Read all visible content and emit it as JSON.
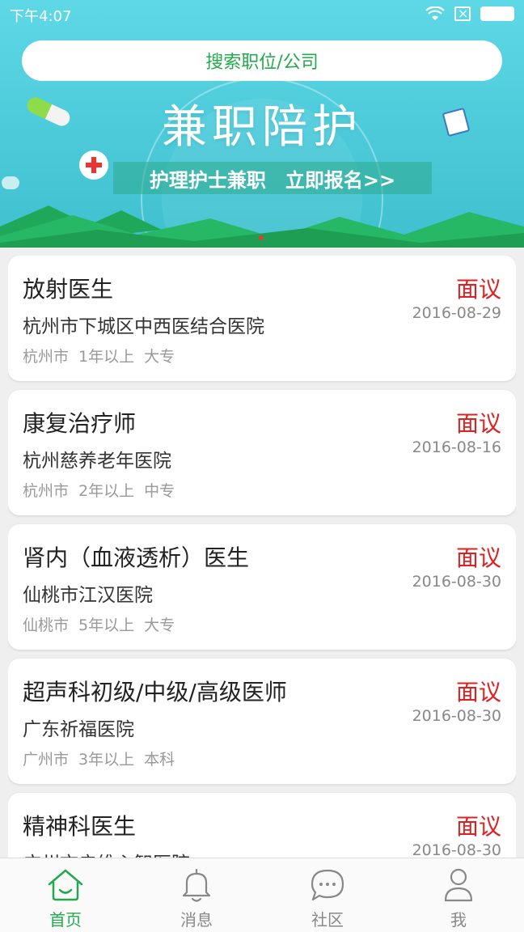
{
  "status_bar": {
    "time": "下午4:07"
  },
  "search": {
    "placeholder": "搜索职位/公司"
  },
  "banner": {
    "title": "兼职陪护",
    "subtitle_left": "护理护士兼职",
    "subtitle_right": "立即报名>>"
  },
  "jobs": [
    {
      "title": "放射医生",
      "salary": "面议",
      "company": "杭州市下城区中西医结合医院",
      "date": "2016-08-29",
      "city": "杭州市",
      "experience": "1年以上",
      "education": "大专"
    },
    {
      "title": "康复治疗师",
      "salary": "面议",
      "company": "杭州慈养老年医院",
      "date": "2016-08-16",
      "city": "杭州市",
      "experience": "2年以上",
      "education": "中专"
    },
    {
      "title": "肾内（血液透析）医生",
      "salary": "面议",
      "company": "仙桃市江汉医院",
      "date": "2016-08-30",
      "city": "仙桃市",
      "experience": "5年以上",
      "education": "大专"
    },
    {
      "title": "超声科初级/中级/高级医师",
      "salary": "面议",
      "company": "广东祈福医院",
      "date": "2016-08-30",
      "city": "广州市",
      "experience": "3年以上",
      "education": "本科"
    },
    {
      "title": "精神科医生",
      "salary": "面议",
      "company": "广州市启维心智医院",
      "date": "2016-08-30",
      "city": "",
      "experience": "",
      "education": ""
    }
  ],
  "tabs": [
    {
      "label": "首页",
      "icon": "home-icon",
      "active": true
    },
    {
      "label": "消息",
      "icon": "bell-icon",
      "active": false
    },
    {
      "label": "社区",
      "icon": "chat-bubble-icon",
      "active": false
    },
    {
      "label": "我",
      "icon": "user-icon",
      "active": false
    }
  ],
  "colors": {
    "accent": "#23a94d",
    "salary": "#e02020",
    "banner": "#4ccad9"
  }
}
